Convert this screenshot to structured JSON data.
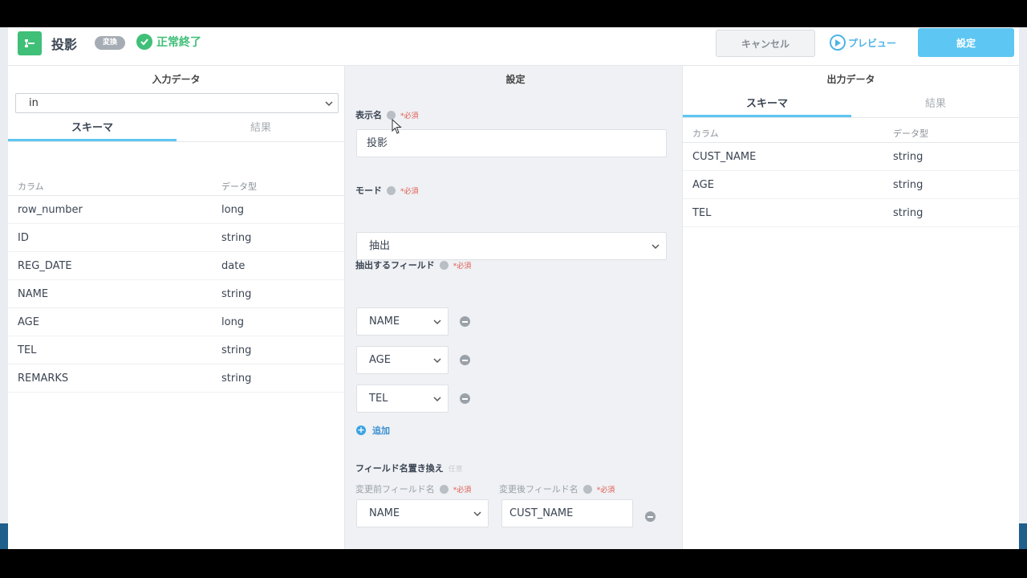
{
  "header": {
    "title": "投影",
    "type_badge": "変換",
    "status": "正常終了",
    "cancel_label": "キャンセル",
    "preview_label": "プレビュー",
    "setting_label": "設定"
  },
  "input_panel": {
    "title": "入力データ",
    "source_select": "in",
    "tabs": [
      "スキーマ",
      "結果"
    ],
    "columns": [
      "カラム",
      "データ型"
    ],
    "rows": [
      {
        "name": "row_number",
        "type": "long"
      },
      {
        "name": "ID",
        "type": "string"
      },
      {
        "name": "REG_DATE",
        "type": "date"
      },
      {
        "name": "NAME",
        "type": "string"
      },
      {
        "name": "AGE",
        "type": "long"
      },
      {
        "name": "TEL",
        "type": "string"
      },
      {
        "name": "REMARKS",
        "type": "string"
      }
    ]
  },
  "settings_panel": {
    "title": "設定",
    "display_name_label": "表示名",
    "required": "*必須",
    "display_name_value": "投影",
    "mode_label": "モード",
    "mode_value": "抽出",
    "extract_fields_label": "抽出するフィールド",
    "extract_fields": [
      "NAME",
      "AGE",
      "TEL"
    ],
    "add_label": "追加",
    "rename_label": "フィールド名置き換え",
    "rename_optional": "任意",
    "before_label": "変更前フィールド名",
    "after_label": "変更後フィールド名",
    "rename_before": "NAME",
    "rename_after": "CUST_NAME"
  },
  "output_panel": {
    "title": "出力データ",
    "tabs": [
      "スキーマ",
      "結果"
    ],
    "columns": [
      "カラム",
      "データ型"
    ],
    "rows": [
      {
        "name": "CUST_NAME",
        "type": "string"
      },
      {
        "name": "AGE",
        "type": "string"
      },
      {
        "name": "TEL",
        "type": "string"
      }
    ]
  },
  "colors": {
    "brand_green": "#3fbf77",
    "accent_blue": "#5ec6f2",
    "required_red": "#e05a4f"
  }
}
